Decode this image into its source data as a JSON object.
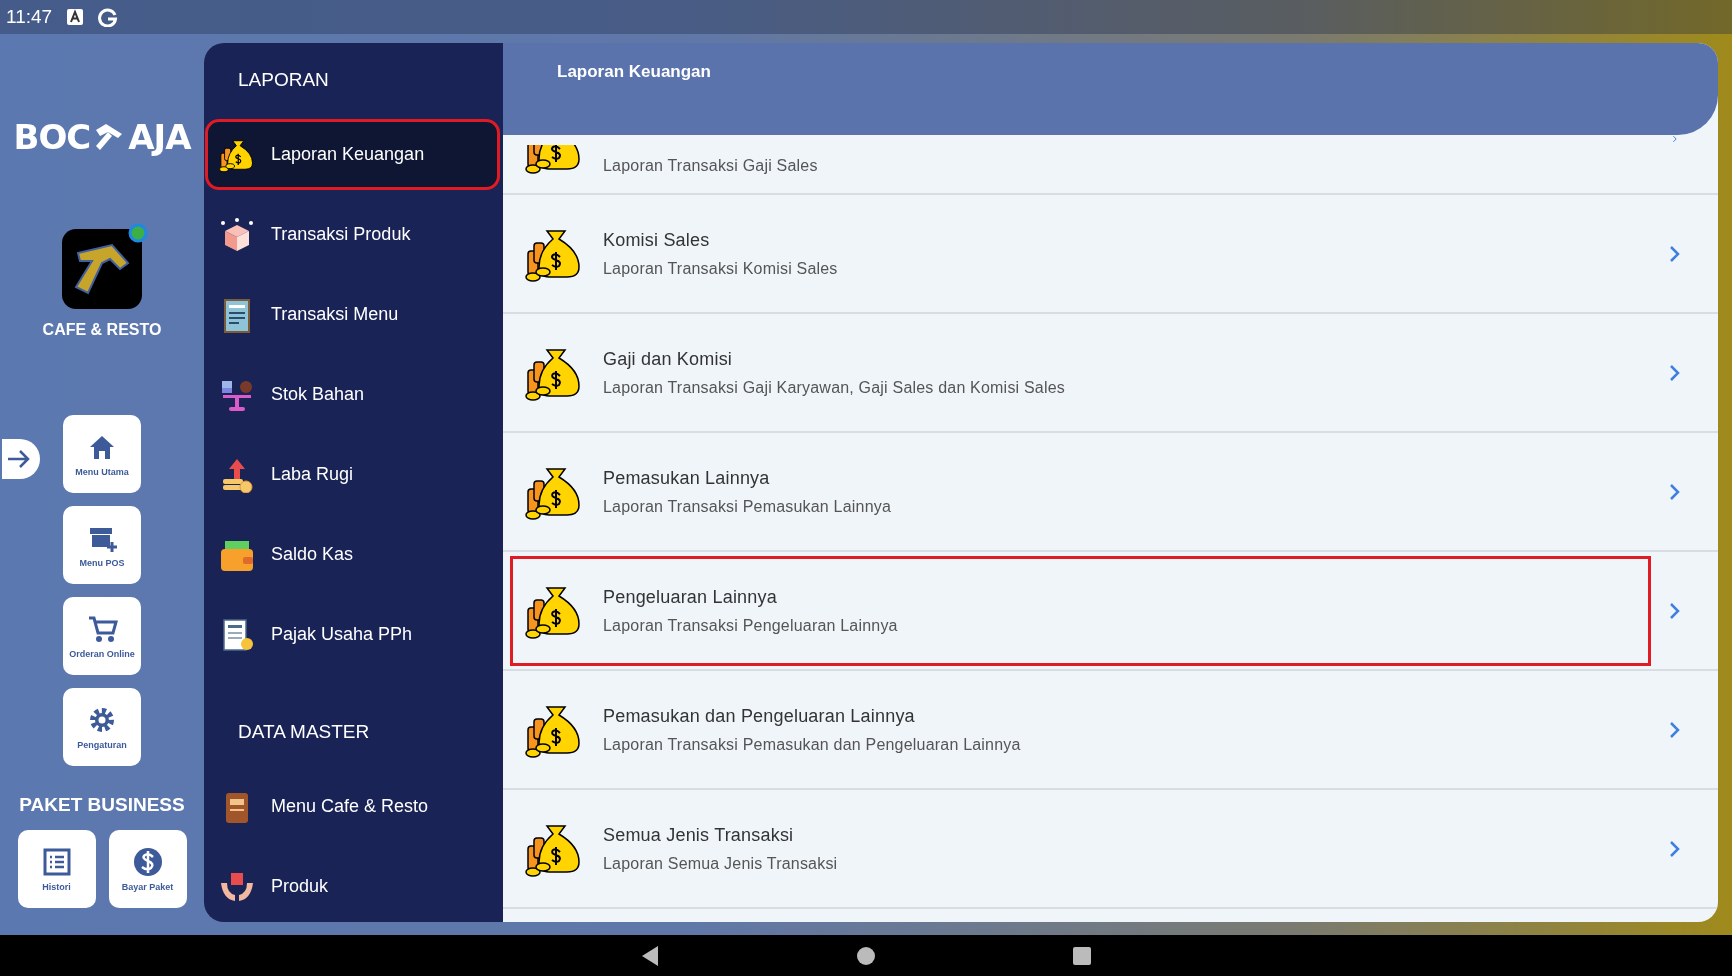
{
  "status_bar": {
    "time": "11:47"
  },
  "rail": {
    "logo_left": "BOC",
    "logo_right": "AJA",
    "app_name": "CAFE & RESTO",
    "dock": [
      {
        "label": "Menu Utama"
      },
      {
        "label": "Menu POS"
      },
      {
        "label": "Orderan Online"
      },
      {
        "label": "Pengaturan"
      }
    ],
    "paket_title": "PAKET BUSINESS",
    "paket_buttons": [
      {
        "label": "Histori"
      },
      {
        "label": "Bayar Paket"
      }
    ]
  },
  "nav": {
    "sections": [
      {
        "title": "LAPORAN",
        "items": [
          {
            "label": "Laporan Keuangan",
            "selected": true,
            "highlighted": true
          },
          {
            "label": "Transaksi Produk",
            "selected": false,
            "highlighted": false
          },
          {
            "label": "Transaksi Menu",
            "selected": false,
            "highlighted": false
          },
          {
            "label": "Stok Bahan",
            "selected": false,
            "highlighted": false
          },
          {
            "label": "Laba Rugi",
            "selected": false,
            "highlighted": false
          },
          {
            "label": "Saldo Kas",
            "selected": false,
            "highlighted": false
          },
          {
            "label": "Pajak Usaha PPh",
            "selected": false,
            "highlighted": false
          }
        ]
      },
      {
        "title": "DATA MASTER",
        "items": [
          {
            "label": "Menu Cafe & Resto",
            "selected": false,
            "highlighted": false
          },
          {
            "label": "Produk",
            "selected": false,
            "highlighted": false
          }
        ]
      }
    ]
  },
  "content": {
    "title": "Laporan Keuangan",
    "rows": [
      {
        "kind": "partial",
        "subtitle": "Laporan Transaksi Gaji Sales",
        "highlighted": false
      },
      {
        "kind": "full",
        "title": "Komisi Sales",
        "subtitle": "Laporan Transaksi Komisi Sales",
        "highlighted": false
      },
      {
        "kind": "full",
        "title": "Gaji dan Komisi",
        "subtitle": "Laporan Transaksi Gaji Karyawan, Gaji Sales dan Komisi Sales",
        "highlighted": false
      },
      {
        "kind": "full",
        "title": "Pemasukan Lainnya",
        "subtitle": "Laporan Transaksi Pemasukan Lainnya",
        "highlighted": false
      },
      {
        "kind": "full",
        "title": "Pengeluaran Lainnya",
        "subtitle": "Laporan Transaksi Pengeluaran Lainnya",
        "highlighted": true
      },
      {
        "kind": "full",
        "title": "Pemasukan dan Pengeluaran Lainnya",
        "subtitle": "Laporan Transaksi Pemasukan dan Pengeluaran Lainnya",
        "highlighted": false
      },
      {
        "kind": "full",
        "title": "Semua Jenis Transaksi",
        "subtitle": "Laporan Semua Jenis Transaksi",
        "highlighted": false
      }
    ]
  }
}
